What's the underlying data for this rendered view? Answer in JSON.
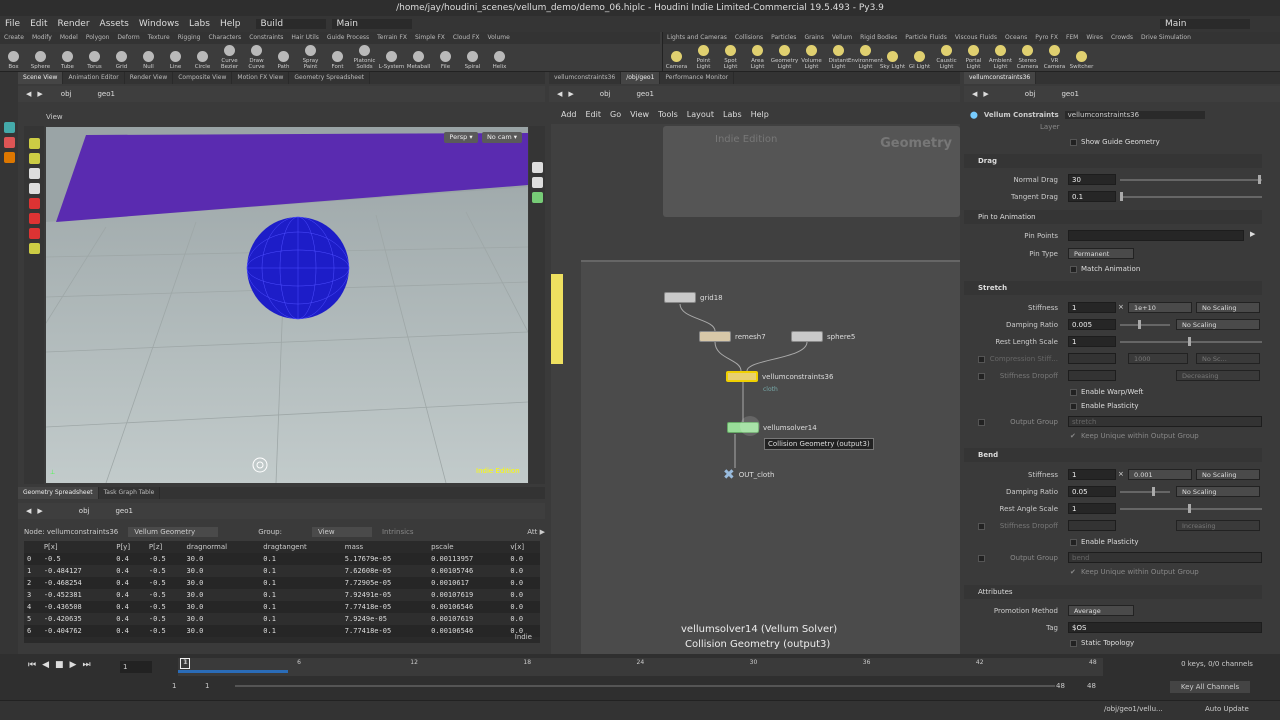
{
  "title": "/home/jay/houdini_scenes/vellum_demo/demo_06.hiplc - Houdini Indie Limited-Commercial 19.5.493 - Py3.9",
  "menu": [
    "File",
    "Edit",
    "Render",
    "Assets",
    "Windows",
    "Labs",
    "Help"
  ],
  "desktop": "Build",
  "main_desktop": "Main",
  "main_desktop_right": "Main",
  "shelf_tabs_left": [
    "Create",
    "Modify",
    "Model",
    "Polygon",
    "Deform",
    "Texture",
    "Rigging",
    "Characters",
    "Constraints",
    "Hair Utils",
    "Guide Process",
    "Terrain FX",
    "Simple FX",
    "Cloud FX",
    "Volume"
  ],
  "shelf_tools_left": [
    "Box",
    "Sphere",
    "Tube",
    "Torus",
    "Grid",
    "Null",
    "Line",
    "Circle",
    "Curve Bezier",
    "Draw Curve",
    "Path",
    "Spray Paint",
    "Font",
    "Platonic Solids",
    "L-System",
    "Metaball",
    "File",
    "Spiral",
    "Helix"
  ],
  "shelf_tabs_right": [
    "Lights and Cameras",
    "Collisions",
    "Particles",
    "Grains",
    "Vellum",
    "Rigid Bodies",
    "Particle Fluids",
    "Viscous Fluids",
    "Oceans",
    "Pyro FX",
    "FEM",
    "Wires",
    "Crowds",
    "Drive Simulation"
  ],
  "shelf_tools_right": [
    "Camera",
    "Point Light",
    "Spot Light",
    "Area Light",
    "Geometry Light",
    "Volume Light",
    "Distant Light",
    "Environment Light",
    "Sky Light",
    "GI Light",
    "Caustic Light",
    "Portal Light",
    "Ambient Light",
    "Stereo Camera",
    "VR Camera",
    "Switcher"
  ],
  "left_tabs": [
    "Scene View",
    "Animation Editor",
    "Render View",
    "Composite View",
    "Motion FX View",
    "Geometry Spreadsheet"
  ],
  "path_obj": "obj",
  "path_geo": "geo1",
  "view_label": "View",
  "persp": "Persp ▾",
  "nocam": "No cam ▾",
  "indie_vp": "Indie Edition",
  "bottom_tabs": [
    "Geometry Spreadsheet",
    "Task Graph Table"
  ],
  "sheet": {
    "node_label": "Node: vellumconstraints36",
    "geo_type": "Vellum Geometry",
    "group": "Group:",
    "view": "View",
    "intrinsics": "Intrinsics",
    "attr": "Att ▶",
    "headers": [
      "",
      "P[x]",
      "P[y]",
      "P[z]",
      "dragnormal",
      "dragtangent",
      "mass",
      "pscale",
      "v[x]"
    ],
    "rows": [
      [
        "0",
        "-0.5",
        "0.4",
        "-0.5",
        "30.0",
        "0.1",
        "5.17679e-05",
        "0.00113957",
        "0.0"
      ],
      [
        "1",
        "-0.484127",
        "0.4",
        "-0.5",
        "30.0",
        "0.1",
        "7.62608e-05",
        "0.00105746",
        "0.0"
      ],
      [
        "2",
        "-0.468254",
        "0.4",
        "-0.5",
        "30.0",
        "0.1",
        "7.72905e-05",
        "0.0010617",
        "0.0"
      ],
      [
        "3",
        "-0.452381",
        "0.4",
        "-0.5",
        "30.0",
        "0.1",
        "7.92491e-05",
        "0.00107619",
        "0.0"
      ],
      [
        "4",
        "-0.436508",
        "0.4",
        "-0.5",
        "30.0",
        "0.1",
        "7.77418e-05",
        "0.00106546",
        "0.0"
      ],
      [
        "5",
        "-0.420635",
        "0.4",
        "-0.5",
        "30.0",
        "0.1",
        "7.9249e-05",
        "0.00107619",
        "0.0"
      ],
      [
        "6",
        "-0.404762",
        "0.4",
        "-0.5",
        "30.0",
        "0.1",
        "7.77418e-05",
        "0.00106546",
        "0.0"
      ]
    ],
    "indie": "Indie"
  },
  "mid_tabs": [
    "vellumconstraints36",
    "/obj/geo1",
    "Performance Monitor"
  ],
  "net_menu": [
    "Add",
    "Edit",
    "Go",
    "View",
    "Tools",
    "Layout",
    "Labs",
    "Help"
  ],
  "net_indie": "Indie Edition",
  "net_geometry": "Geometry",
  "nodes": {
    "grid": "grid18",
    "remesh": "remesh7",
    "sphere": "sphere5",
    "constraints": "vellumconstraints36",
    "cloth": "cloth",
    "solver": "vellumsolver14",
    "out": "OUT_cloth"
  },
  "tooltip": "Collision Geometry (output3)",
  "net_footer1": "vellumsolver14 (Vellum Solver)",
  "net_footer2": "Collision Geometry (output3)",
  "right_tabs": [
    "vellumconstraints36"
  ],
  "params": {
    "type_label": "Vellum Constraints",
    "node_name": "vellumconstraints36",
    "layer": "Layer",
    "show_guide": "Show Guide Geometry",
    "drag": "Drag",
    "normal_drag": "Normal Drag",
    "normal_drag_v": "30",
    "tangent_drag": "Tangent Drag",
    "tangent_drag_v": "0.1",
    "pin": "Pin to Animation",
    "pin_points": "Pin Points",
    "pin_type": "Pin Type",
    "pin_type_v": "Permanent",
    "match_anim": "Match Animation",
    "stretch": "Stretch",
    "stiffness": "Stiffness",
    "stiff_v": "1",
    "stiff_mult": "1e+10",
    "no_scaling": "No Scaling",
    "damping": "Damping Ratio",
    "damp_v": "0.005",
    "rest_len": "Rest Length Scale",
    "rest_len_v": "1",
    "compression": "Compression Stiff...",
    "comp_v": "1000",
    "no_sc": "No Sc...",
    "stiff_dropoff": "Stiffness Dropoff",
    "decreasing": "Decreasing",
    "warp": "Enable Warp/Weft",
    "plasticity": "Enable Plasticity",
    "output_group": "Output Group",
    "og_v": "stretch",
    "keep_unique": "Keep Unique within Output Group",
    "bend": "Bend",
    "b_stiff_v": "1",
    "b_mult": "0.001",
    "b_damp_v": "0.05",
    "rest_angle": "Rest Angle Scale",
    "rest_angle_v": "1",
    "increasing": "Increasing",
    "b_og_v": "bend",
    "attributes": "Attributes",
    "promo": "Promotion Method",
    "promo_v": "Average",
    "tag": "Tag",
    "tag_v": "$OS",
    "static": "Static Topology"
  },
  "timeline": {
    "frame": "1",
    "start": "1",
    "start2": "1",
    "end": "48",
    "end2": "48",
    "ticks": [
      "1",
      "6",
      "12",
      "18",
      "24",
      "30",
      "36",
      "42",
      "48"
    ],
    "keys": "0 keys, 0/0 channels",
    "key_all": "Key All Channels"
  },
  "status": {
    "path": "/obj/geo1/vellu...",
    "auto": "Auto Update"
  }
}
